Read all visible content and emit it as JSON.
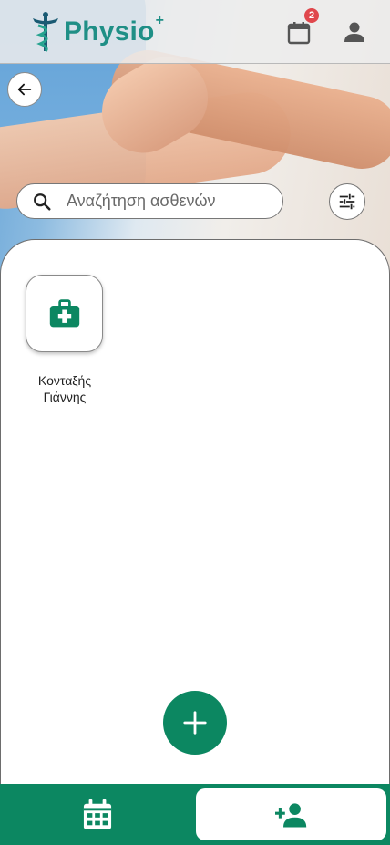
{
  "header": {
    "logo_text": "Physio",
    "logo_plus": "+",
    "notification_count": "2"
  },
  "search": {
    "placeholder": "Αναζήτηση ασθενών",
    "value": ""
  },
  "patients": [
    {
      "name": "Κονταξής Γιάννης"
    }
  ],
  "icons": {
    "back": "arrow-left-icon",
    "calendar": "calendar-icon",
    "user": "user-icon",
    "search": "search-icon",
    "filter": "sliders-icon",
    "patient": "medical-kit-icon",
    "add": "plus-icon",
    "add_patient": "add-user-icon"
  },
  "colors": {
    "brand": "#0c8761",
    "logo": "#1f8f86",
    "badge": "#e0474c"
  }
}
